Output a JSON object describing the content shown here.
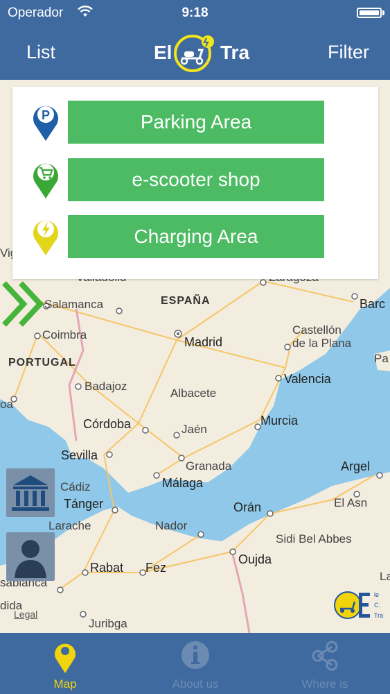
{
  "status_bar": {
    "carrier": "Operador",
    "time": "9:18"
  },
  "nav_bar": {
    "left_label": "List",
    "right_label": "Filter",
    "brand_left": "El",
    "brand_right": "Tra"
  },
  "panel": {
    "items": [
      {
        "label": "Parking Area",
        "icon": "parking-pin-icon",
        "color": "#1f5fa8"
      },
      {
        "label": "e-scooter shop",
        "icon": "shop-cart-pin-icon",
        "color": "#3aa836"
      },
      {
        "label": "Charging Area",
        "icon": "charging-bolt-pin-icon",
        "color": "#e2d51a"
      }
    ],
    "button_color": "#4cbb63"
  },
  "map": {
    "legal": "Legal",
    "labels": {
      "vigo": "Vig",
      "valladolid": "Valladolid",
      "zaragoza": "Zaragoza",
      "barcelona": "Barc",
      "salamanca": "Salamanca",
      "espana": "ESPAÑA",
      "castellon": "Castellón",
      "castellon2": "de la Plana",
      "coimbra": "Coimbra",
      "madrid": "Madrid",
      "portugal": "PORTUGAL",
      "palma": "Pa",
      "valencia": "Valencia",
      "badajoz": "Badajoz",
      "albacete": "Albacete",
      "lisboa": "oa",
      "cordoba": "Córdoba",
      "jaen": "Jaén",
      "murcia": "Murcia",
      "sevilla": "Sevilla",
      "granada": "Granada",
      "argel": "Argel",
      "cadiz": "Cádiz",
      "malaga": "Málaga",
      "tanger": "Tánger",
      "el_asnam": "El Asn",
      "oran": "Orán",
      "larache": "Larache",
      "nador": "Nador",
      "sidi": "Sidi Bel Abbes",
      "rabat": "Rabat",
      "fez": "Fez",
      "oujda": "Oujda",
      "casablanca": "sablanca",
      "la": "La",
      "kenitra": "dida",
      "juribga": "Juribga"
    }
  },
  "corner_logo": {
    "lines": [
      "le",
      "C.",
      "Tra"
    ]
  },
  "tab_bar": {
    "tabs": [
      {
        "label": "Map",
        "icon": "map-pin-icon",
        "active": true
      },
      {
        "label": "About us",
        "icon": "info-icon",
        "active": false
      },
      {
        "label": "Where is",
        "icon": "share-icon",
        "active": false
      }
    ],
    "active_color": "#f2d40c",
    "inactive_color": "#6c8bb3"
  }
}
